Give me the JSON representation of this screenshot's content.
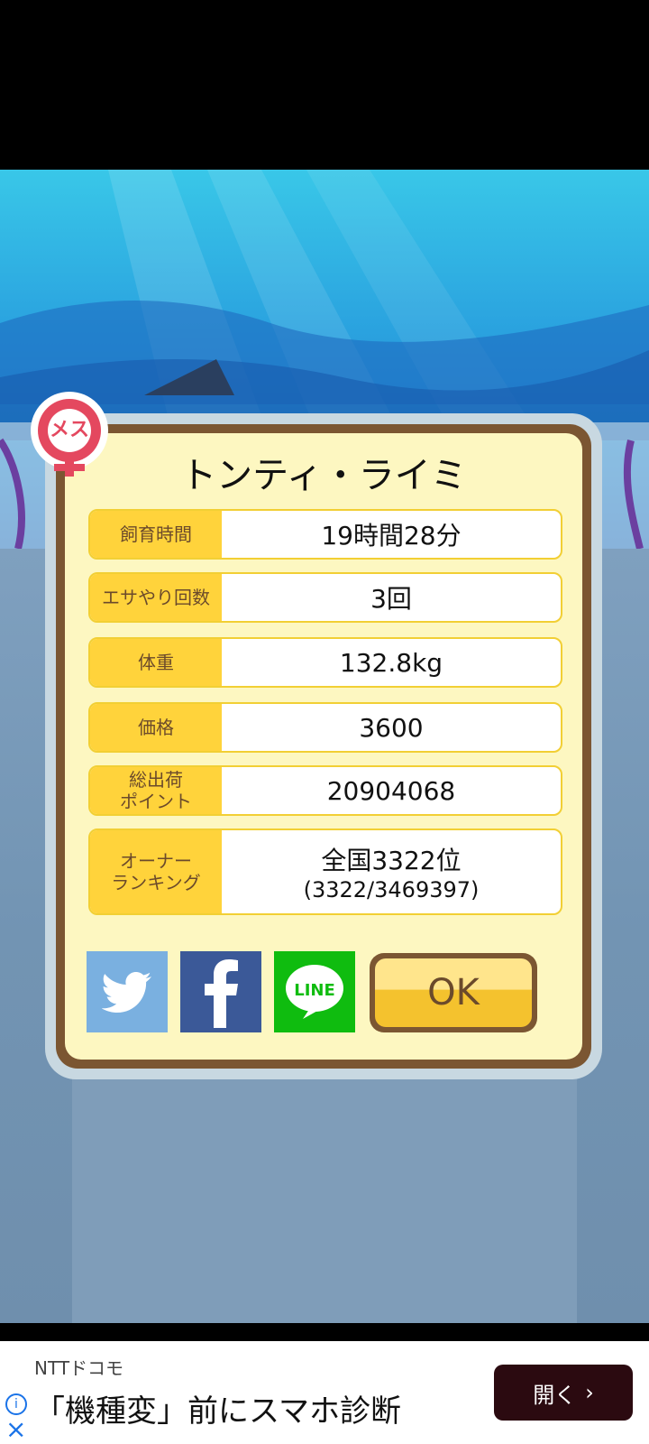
{
  "colors": {
    "accent_yellow": "#ffd33b",
    "card_border": "#7b5632",
    "card_bg": "#fdf7c1",
    "female": "#e4485f"
  },
  "badge": {
    "text": "メス"
  },
  "title": "トンティ・ライミ",
  "stats": [
    {
      "label": "飼育時間",
      "value": "19時間28分"
    },
    {
      "label": "エサやり回数",
      "value": "3回"
    },
    {
      "label": "体重",
      "value": "132.8kg"
    },
    {
      "label": "価格",
      "value": "3600"
    },
    {
      "label": "総出荷\nポイント",
      "value": "20904068"
    },
    {
      "label": "オーナー\nランキング",
      "value": "全国3322位",
      "sub": "(3322/3469397)"
    }
  ],
  "share": {
    "twitter_icon": "twitter-icon",
    "facebook_icon": "facebook-icon",
    "line_label": "LINE"
  },
  "ok_label": "OK",
  "ad": {
    "brand": "NTTドコモ",
    "headline": "「機種変」前にスマホ診断",
    "open_label": "開く",
    "info_icon": "i",
    "close_icon": "×"
  }
}
